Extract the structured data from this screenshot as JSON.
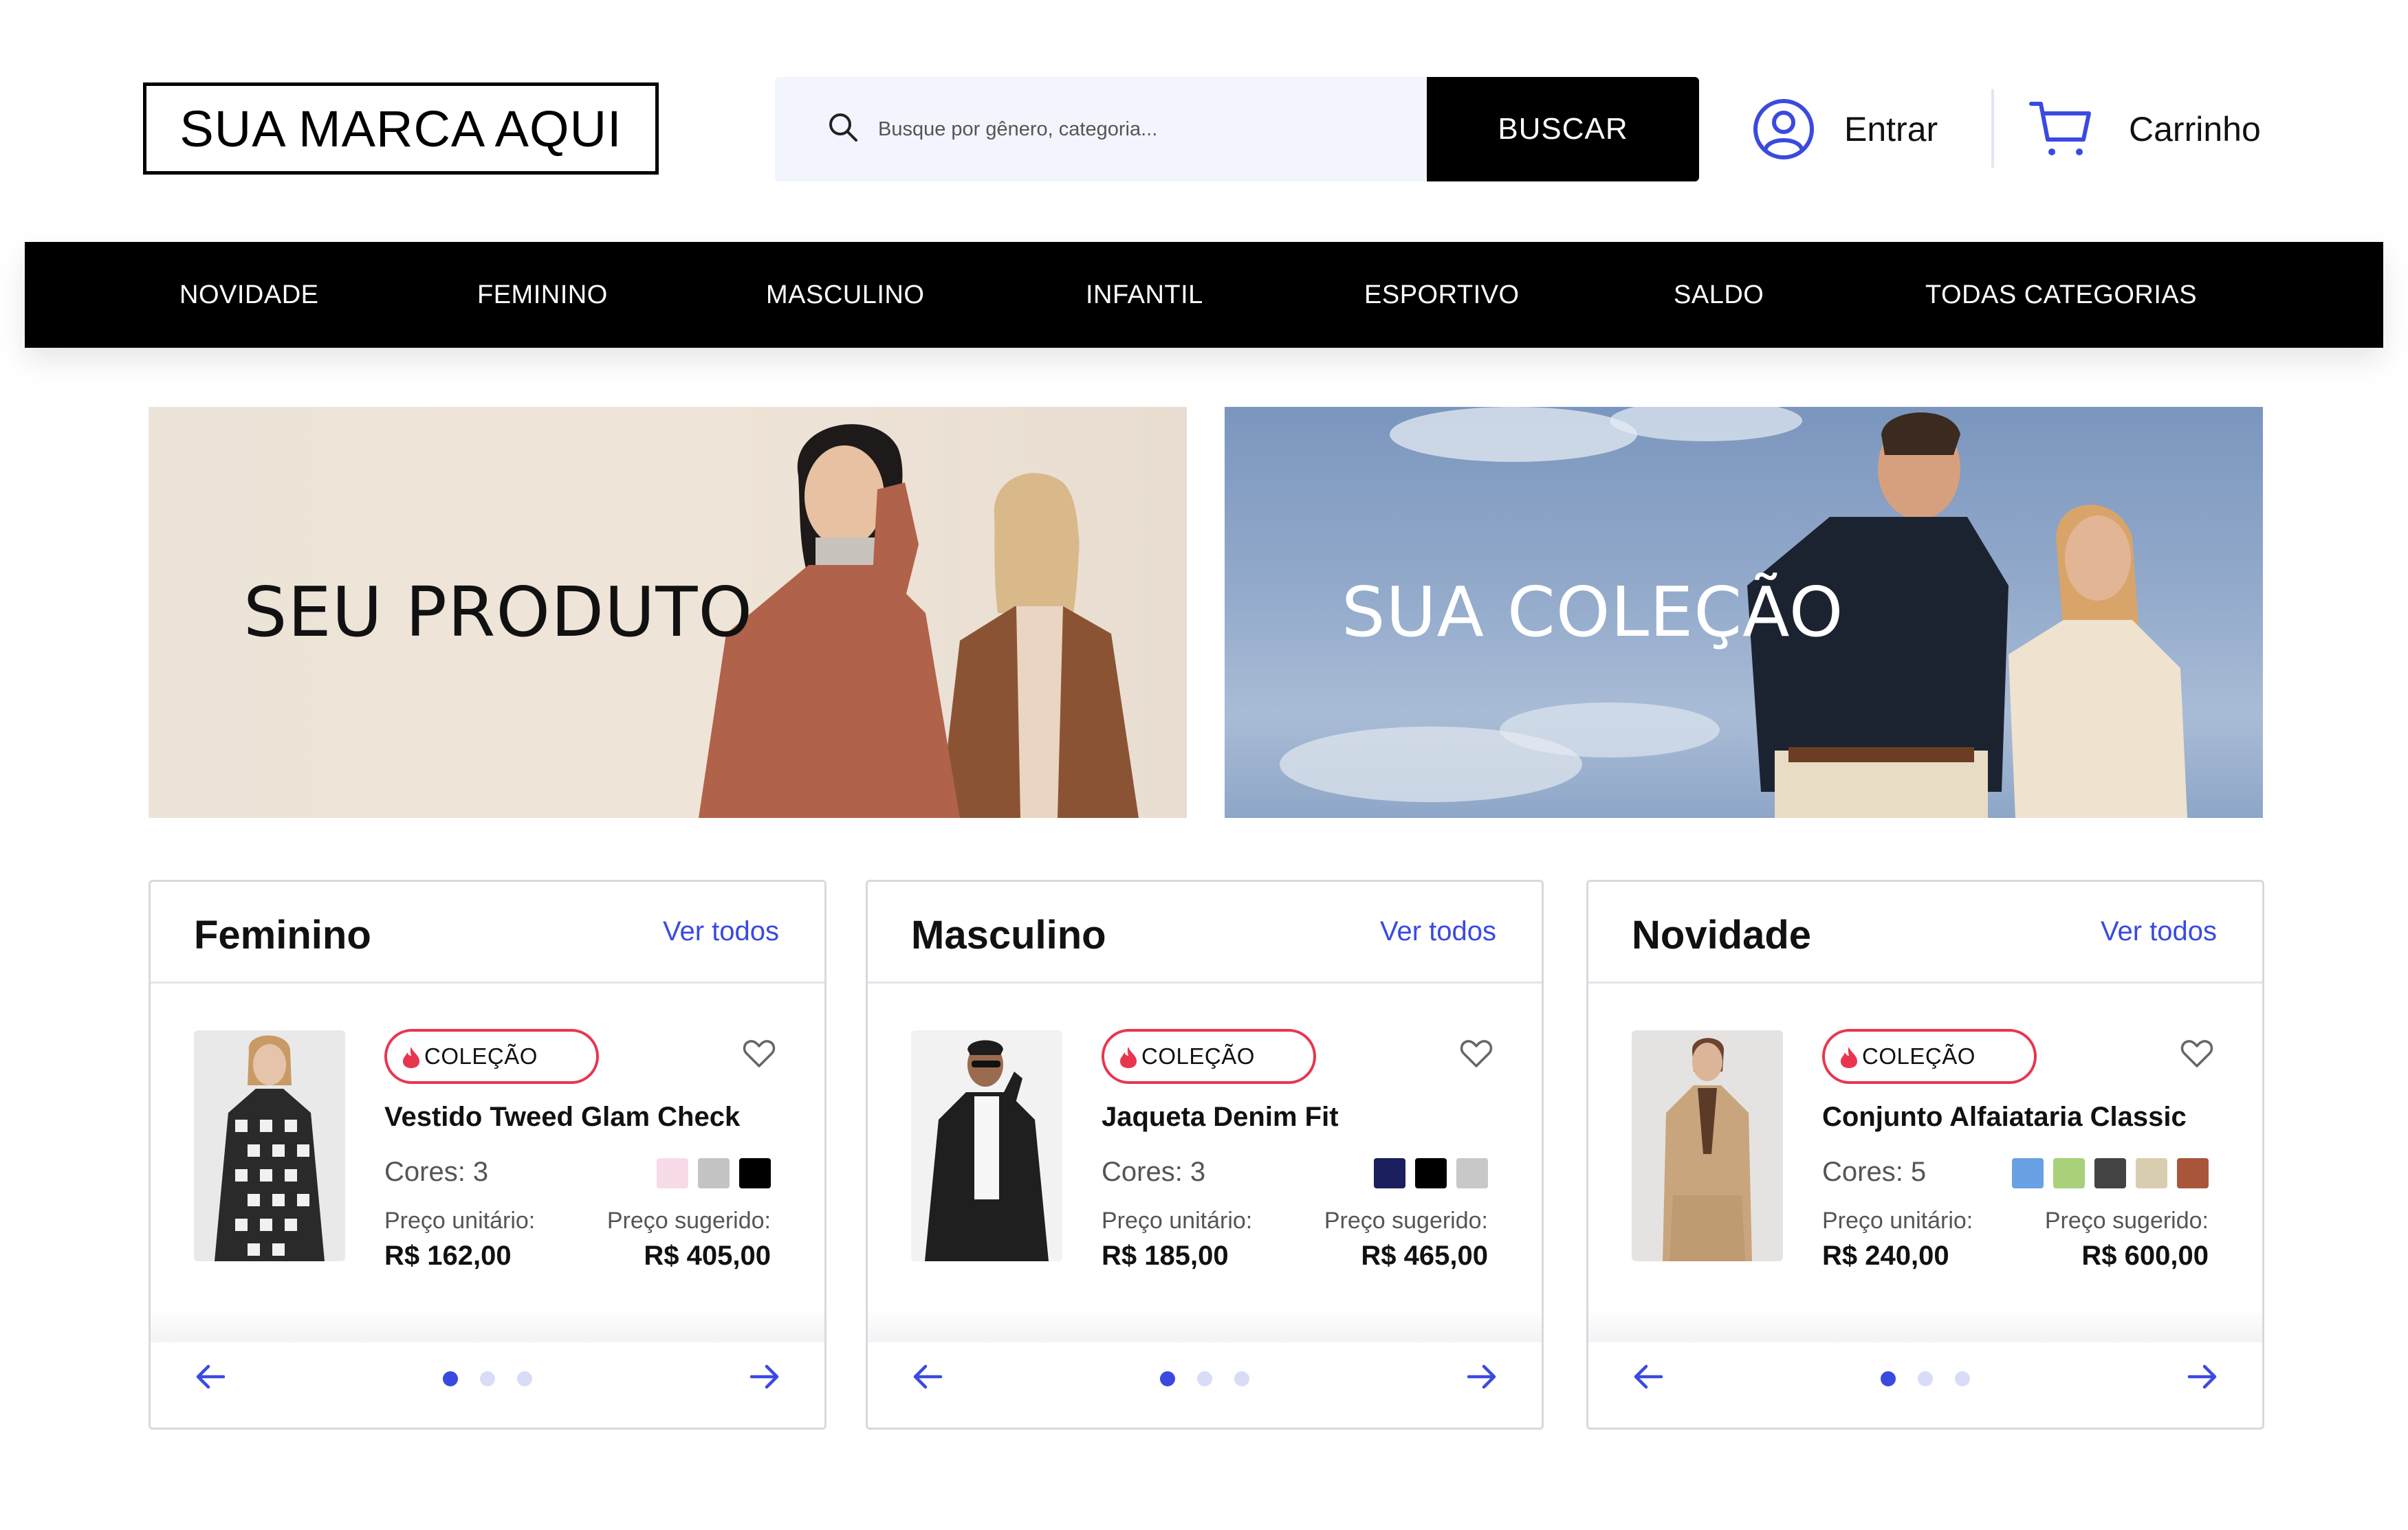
{
  "header": {
    "logo_text": "SUA MARCA AQUI",
    "search": {
      "placeholder": "Busque por gênero, categoria...",
      "button_label": "BUSCAR",
      "icon": "search-icon"
    },
    "account": {
      "label": "Entrar",
      "icon": "user-circle-icon"
    },
    "cart": {
      "label": "Carrinho",
      "icon": "shopping-cart-icon"
    }
  },
  "nav": {
    "items": [
      {
        "label": "NOVIDADE"
      },
      {
        "label": "FEMININO"
      },
      {
        "label": "MASCULINO"
      },
      {
        "label": "INFANTIL"
      },
      {
        "label": "ESPORTIVO"
      },
      {
        "label": "SALDO"
      },
      {
        "label": "TODAS CATEGORIAS"
      }
    ]
  },
  "banners": [
    {
      "title": "SEU PRODUTO"
    },
    {
      "title": "SUA COLEÇÃO"
    }
  ],
  "cards": [
    {
      "title": "Feminino",
      "see_all": "Ver todos",
      "badge": "COLEÇÃO",
      "product_name": "Vestido Tweed Glam Check",
      "colors_label": "Cores: 3",
      "swatches": [
        "#f7dbe8",
        "#c4c4c4",
        "#000000"
      ],
      "unit_price_label": "Preço unitário:",
      "unit_price": "R$ 162,00",
      "suggested_price_label": "Preço sugerido:",
      "suggested_price": "R$ 405,00",
      "pagination": {
        "total": 3,
        "active": 1
      }
    },
    {
      "title": "Masculino",
      "see_all": "Ver todos",
      "badge": "COLEÇÃO",
      "product_name": "Jaqueta Denim Fit",
      "colors_label": "Cores: 3",
      "swatches": [
        "#1b1f5e",
        "#000000",
        "#c8c8c8"
      ],
      "unit_price_label": "Preço unitário:",
      "unit_price": "R$ 185,00",
      "suggested_price_label": "Preço sugerido:",
      "suggested_price": "R$ 465,00",
      "pagination": {
        "total": 3,
        "active": 1
      }
    },
    {
      "title": "Novidade",
      "see_all": "Ver todos",
      "badge": "COLEÇÃO",
      "product_name": "Conjunto Alfaiataria Classic",
      "colors_label": "Cores: 5",
      "swatches": [
        "#6aa0e4",
        "#a8d17a",
        "#434343",
        "#d9cdb0",
        "#a9553a"
      ],
      "unit_price_label": "Preço unitário:",
      "unit_price": "R$ 240,00",
      "suggested_price_label": "Preço sugerido:",
      "suggested_price": "R$ 600,00",
      "pagination": {
        "total": 3,
        "active": 1
      }
    }
  ],
  "colors": {
    "accent": "#3a4ae0",
    "badge_border": "#e8364f",
    "nav_bg": "#000000",
    "search_bg": "#f2f5fd"
  }
}
